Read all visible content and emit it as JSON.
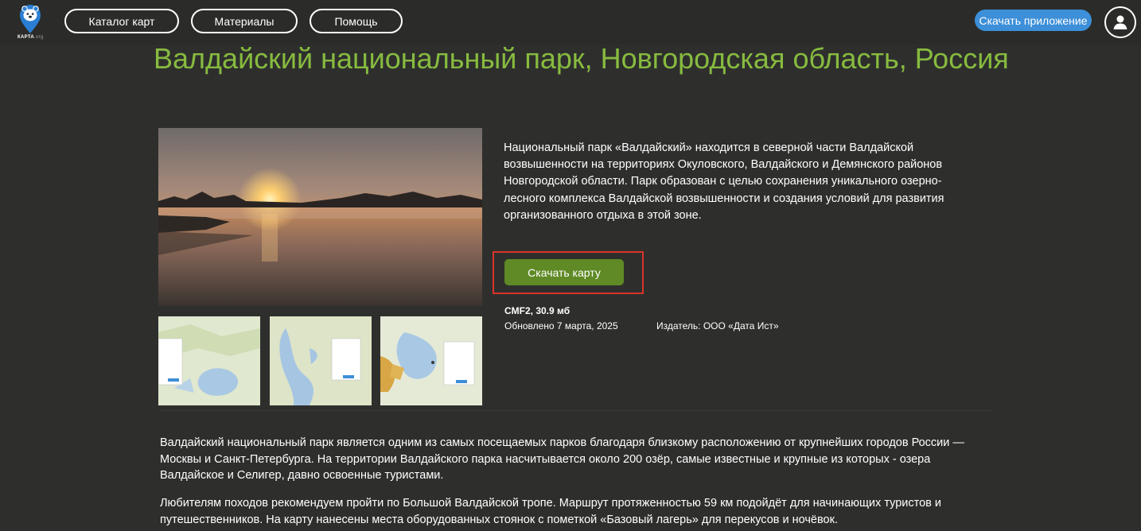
{
  "header": {
    "logo": {
      "icon": "bear-pin-icon",
      "text_main": "КАРТА",
      "text_suffix": ".org",
      "color": "#2a7fd4"
    },
    "nav": [
      {
        "label": "Каталог карт"
      },
      {
        "label": "Материалы"
      },
      {
        "label": "Помощь"
      }
    ],
    "download_app_label": "Скачать приложение",
    "avatar_icon": "user-icon"
  },
  "page": {
    "title": "Валдайский национальный парк, Новгородская область, Россия",
    "description": "Национальный парк «Валдайский» находится в северной части Валдайской возвышенности на территориях Окуловского, Валдайского и Демянского районов Новгородской области. Парк образован с целью сохранения уникального озерно-лесного комплекса Валдайской возвышенности и создания условий для развития организованного отдыха в этой зоне.",
    "download_map_label": "Скачать карту",
    "file_info": "CMF2, 30.9 мб",
    "updated": "Обновлено 7 марта, 2025",
    "publisher": "Издатель: ООО «Дата Ист»",
    "paragraphs": [
      "Валдайский национальный парк является одним из самых посещаемых парков благодаря близкому расположению от крупнейших городов России — Москвы и Санкт-Петербурга. На территории Валдайского парка насчитывается около 200 озёр, самые известные и крупные из которых - озера Валдайское и Селигер, давно освоенные туристами.",
      "Любителям походов рекомендуем пройти по Большой Валдайской тропе. Маршрут протяженностью 59 км подойдёт для начинающих туристов и путешественников. На карту нанесены места оборудованных стоянок с пометкой «Базовый лагерь» для перекусов и ночёвок."
    ]
  },
  "colors": {
    "background": "#2e2f2d",
    "title": "#87bb3f",
    "download_app": "#3c8fd8",
    "download_map": "#5f8a25",
    "highlight": "#d9342b"
  }
}
